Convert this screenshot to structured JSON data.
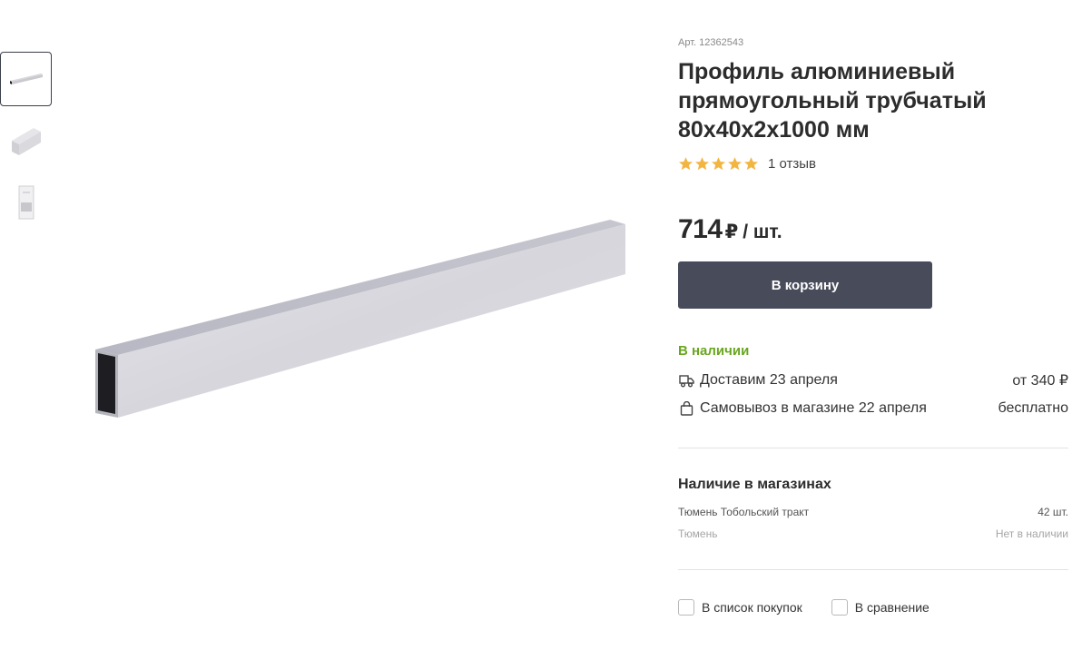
{
  "product": {
    "sku": "Арт. 12362543",
    "title": "Профиль алюминиевый прямоугольный трубчатый 80х40х2х1000 мм",
    "rating": 5,
    "reviews": "1 отзыв",
    "price": {
      "value": "714",
      "currency": "₽",
      "unit": "/ шт."
    }
  },
  "cart": {
    "label": "В корзину"
  },
  "availability": {
    "status": "В наличии",
    "status_color": "#6aa620",
    "delivery": {
      "label": "Доставим 23 апреля",
      "price": "от 340 ₽",
      "icon": "truck-icon"
    },
    "pickup": {
      "label": "Самовывоз в магазине 22 апреля",
      "price": "бесплатно",
      "icon": "shopping-bag-icon"
    }
  },
  "stores": {
    "title": "Наличие в магазинах",
    "items": [
      {
        "name": "Тюмень Тобольский тракт",
        "qty": "42 шт."
      },
      {
        "name": "Тюмень",
        "qty": "Нет в наличии"
      }
    ]
  },
  "actions": {
    "shopping_list": "В список покупок",
    "compare": "В сравнение"
  },
  "colors": {
    "button": "#474b5a",
    "star": "#f2b542",
    "in_stock": "#6aa620"
  }
}
